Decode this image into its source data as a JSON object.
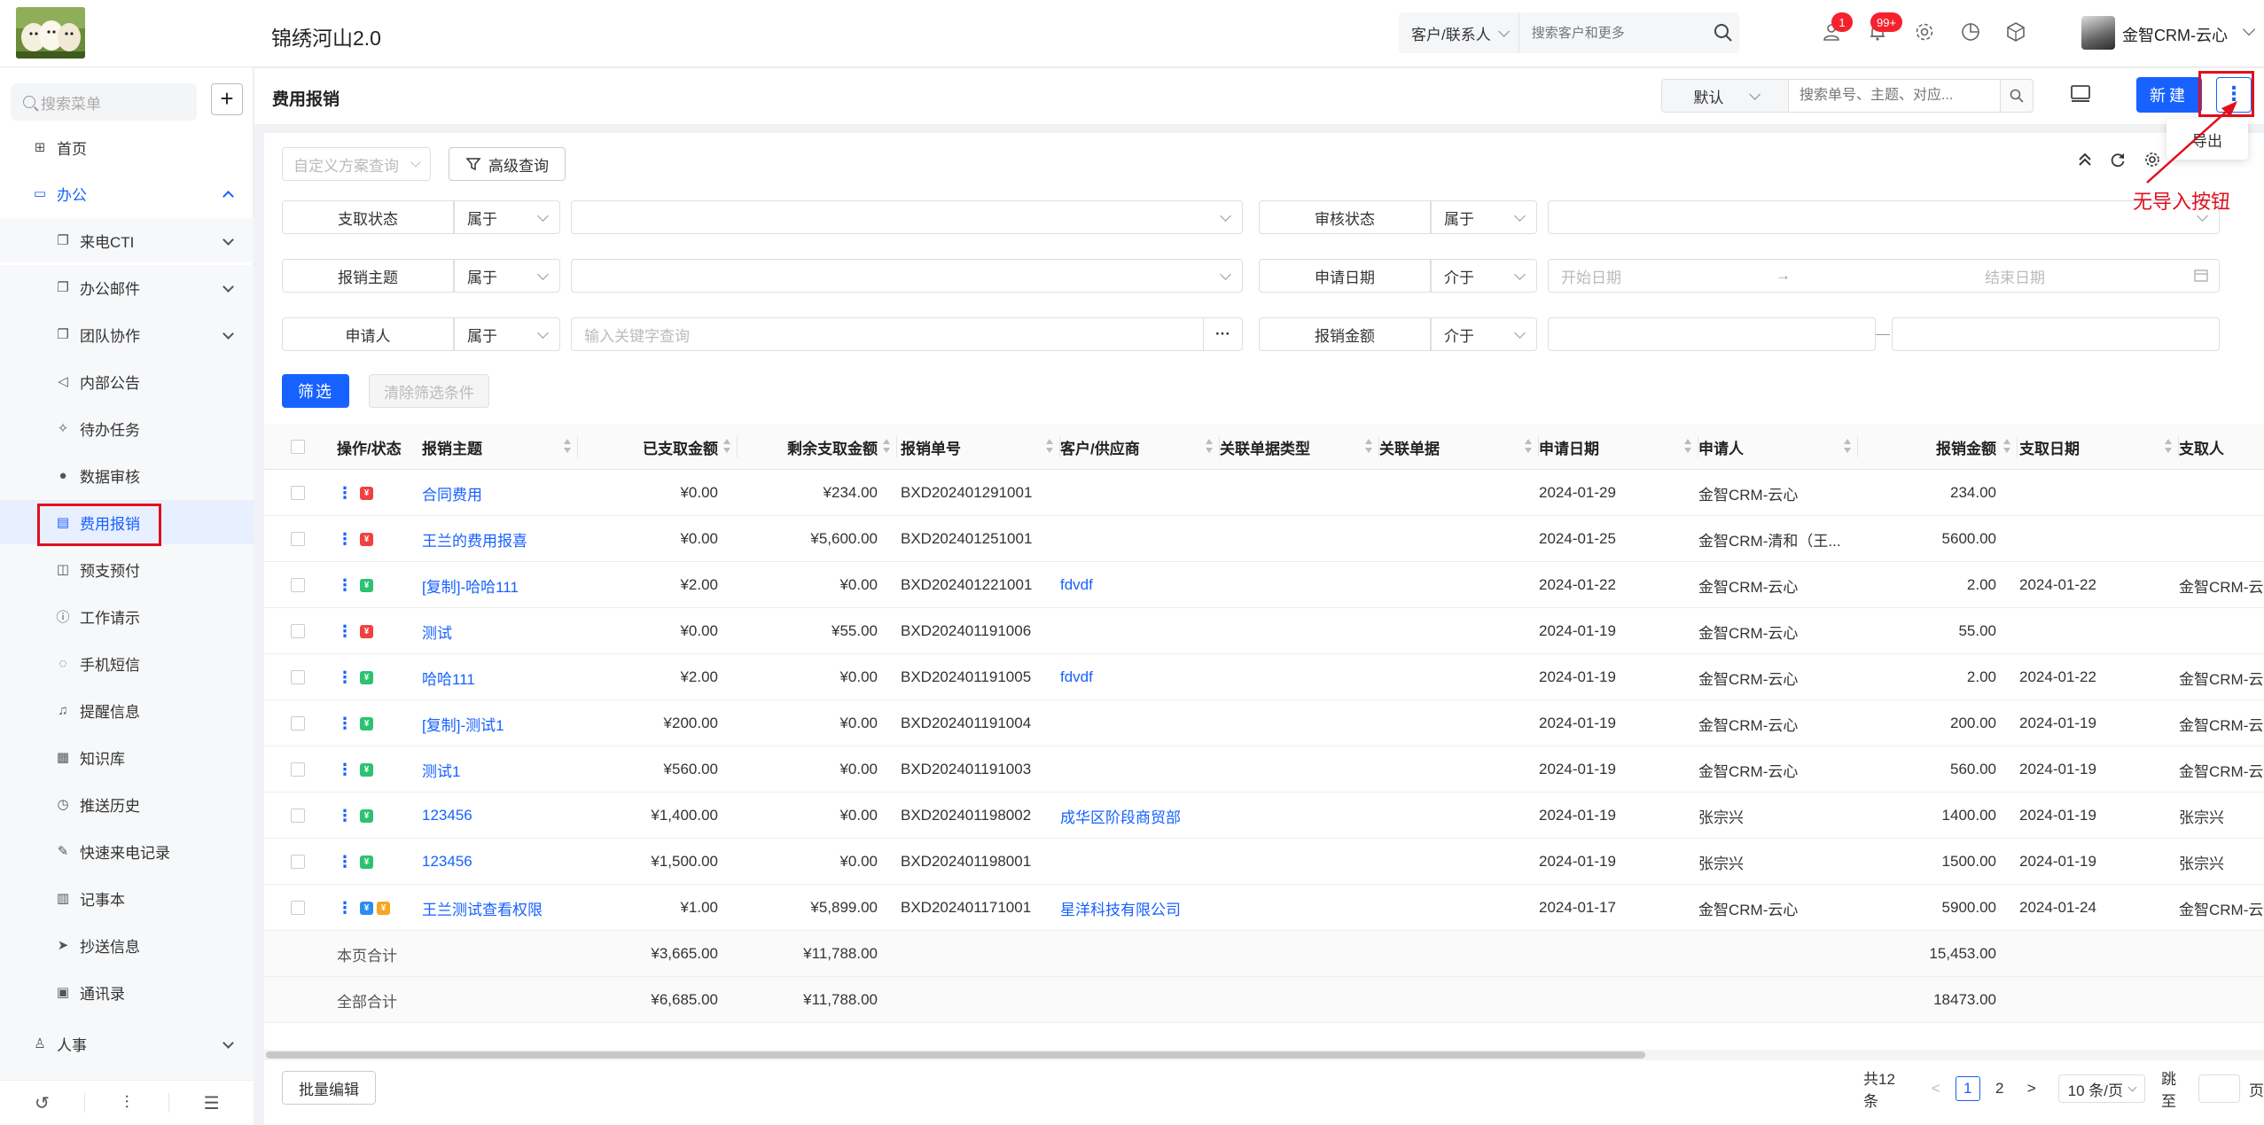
{
  "header": {
    "app_title": "锦绣河山2.0",
    "search_type": "客户/联系人",
    "search_placeholder": "搜索客户和更多",
    "badge_tasks": "1",
    "badge_notices": "99+",
    "user_name": "金智CRM-云心"
  },
  "sidebar": {
    "search_placeholder": "搜索菜单",
    "add_label": "+",
    "items": [
      {
        "label": "首页"
      },
      {
        "label": "办公"
      },
      {
        "label": "来电CTI"
      },
      {
        "label": "办公邮件"
      },
      {
        "label": "团队协作"
      },
      {
        "label": "内部公告"
      },
      {
        "label": "待办任务"
      },
      {
        "label": "数据审核"
      },
      {
        "label": "费用报销"
      },
      {
        "label": "预支预付"
      },
      {
        "label": "工作请示"
      },
      {
        "label": "手机短信"
      },
      {
        "label": "提醒信息"
      },
      {
        "label": "知识库"
      },
      {
        "label": "推送历史"
      },
      {
        "label": "快速来电记录"
      },
      {
        "label": "记事本"
      },
      {
        "label": "抄送信息"
      },
      {
        "label": "通讯录"
      },
      {
        "label": "人事"
      }
    ]
  },
  "page": {
    "title": "费用报销",
    "scheme": "默认",
    "quick_search_placeholder": "搜索单号、主题、对应...",
    "new_label": "新建",
    "more_label": "⋮",
    "export_label": "导出",
    "annotation": "无导入按钮"
  },
  "filters": {
    "custom_scheme_placeholder": "自定义方案查询",
    "advanced_label": "高级查询",
    "rows": [
      {
        "label": "支取状态",
        "op": "属于",
        "value": "",
        "label2": "审核状态",
        "op2": "属于",
        "value2": ""
      },
      {
        "label": "报销主题",
        "op": "属于",
        "value": "",
        "label2": "申请日期",
        "op2": "介于",
        "start": "开始日期",
        "end": "结束日期"
      },
      {
        "label": "申请人",
        "op": "属于",
        "value": "输入关键字查询",
        "label2": "报销金额",
        "op2": "介于"
      }
    ],
    "filter_btn": "筛选",
    "clear_btn": "清除筛选条件"
  },
  "table": {
    "columns": [
      "操作/状态",
      "报销主题",
      "已支取金额",
      "剩余支取金额",
      "报销单号",
      "客户/供应商",
      "关联单据类型",
      "关联单据",
      "申请日期",
      "申请人",
      "报销金额",
      "支取日期",
      "支取人"
    ],
    "rows": [
      {
        "status": [
          "red"
        ],
        "subject": "合同费用",
        "paid": "¥0.00",
        "remain": "¥234.00",
        "no": "BXD202401291001",
        "customer": "",
        "reltype": "",
        "rel": "",
        "date": "2024-01-29",
        "applicant": "金智CRM-云心",
        "amount": "234.00",
        "paydate": "",
        "payer": ""
      },
      {
        "status": [
          "red"
        ],
        "subject": "王兰的费用报喜",
        "paid": "¥0.00",
        "remain": "¥5,600.00",
        "no": "BXD202401251001",
        "customer": "",
        "reltype": "",
        "rel": "",
        "date": "2024-01-25",
        "applicant": "金智CRM-清和（王...",
        "amount": "5600.00",
        "paydate": "",
        "payer": ""
      },
      {
        "status": [
          "green"
        ],
        "subject": "[复制]-哈哈111",
        "paid": "¥2.00",
        "remain": "¥0.00",
        "no": "BXD202401221001",
        "customer": "fdvdf",
        "reltype": "",
        "rel": "",
        "date": "2024-01-22",
        "applicant": "金智CRM-云心",
        "amount": "2.00",
        "paydate": "2024-01-22",
        "payer": "金智CRM-云"
      },
      {
        "status": [
          "red"
        ],
        "subject": "测试",
        "paid": "¥0.00",
        "remain": "¥55.00",
        "no": "BXD202401191006",
        "customer": "",
        "reltype": "",
        "rel": "",
        "date": "2024-01-19",
        "applicant": "金智CRM-云心",
        "amount": "55.00",
        "paydate": "",
        "payer": ""
      },
      {
        "status": [
          "green"
        ],
        "subject": "哈哈111",
        "paid": "¥2.00",
        "remain": "¥0.00",
        "no": "BXD202401191005",
        "customer": "fdvdf",
        "reltype": "",
        "rel": "",
        "date": "2024-01-19",
        "applicant": "金智CRM-云心",
        "amount": "2.00",
        "paydate": "2024-01-22",
        "payer": "金智CRM-云"
      },
      {
        "status": [
          "green"
        ],
        "subject": "[复制]-测试1",
        "paid": "¥200.00",
        "remain": "¥0.00",
        "no": "BXD202401191004",
        "customer": "",
        "reltype": "",
        "rel": "",
        "date": "2024-01-19",
        "applicant": "金智CRM-云心",
        "amount": "200.00",
        "paydate": "2024-01-19",
        "payer": "金智CRM-云"
      },
      {
        "status": [
          "green"
        ],
        "subject": "测试1",
        "paid": "¥560.00",
        "remain": "¥0.00",
        "no": "BXD202401191003",
        "customer": "",
        "reltype": "",
        "rel": "",
        "date": "2024-01-19",
        "applicant": "金智CRM-云心",
        "amount": "560.00",
        "paydate": "2024-01-19",
        "payer": "金智CRM-云"
      },
      {
        "status": [
          "green"
        ],
        "subject": "123456",
        "paid": "¥1,400.00",
        "remain": "¥0.00",
        "no": "BXD202401198002",
        "customer": "成华区阶段商贸部",
        "reltype": "",
        "rel": "",
        "date": "2024-01-19",
        "applicant": "张宗兴",
        "amount": "1400.00",
        "paydate": "2024-01-19",
        "payer": "张宗兴"
      },
      {
        "status": [
          "green"
        ],
        "subject": "123456",
        "paid": "¥1,500.00",
        "remain": "¥0.00",
        "no": "BXD202401198001",
        "customer": "",
        "reltype": "",
        "rel": "",
        "date": "2024-01-19",
        "applicant": "张宗兴",
        "amount": "1500.00",
        "paydate": "2024-01-19",
        "payer": "张宗兴"
      },
      {
        "status": [
          "blue",
          "orange"
        ],
        "subject": "王兰测试查看权限",
        "paid": "¥1.00",
        "remain": "¥5,899.00",
        "no": "BXD202401171001",
        "customer": "星洋科技有限公司",
        "reltype": "",
        "rel": "",
        "date": "2024-01-17",
        "applicant": "金智CRM-云心",
        "amount": "5900.00",
        "paydate": "2024-01-24",
        "payer": "金智CRM-云"
      }
    ],
    "page_total": {
      "label": "本页合计",
      "paid": "¥3,665.00",
      "remain": "¥11,788.00",
      "amount": "15,453.00"
    },
    "all_total": {
      "label": "全部合计",
      "paid": "¥6,685.00",
      "remain": "¥11,788.00",
      "amount": "18473.00"
    }
  },
  "footer": {
    "batch_edit": "批量编辑",
    "total": "共12条",
    "prev": "<",
    "page1": "1",
    "page2": "2",
    "next": ">",
    "page_size": "10 条/页",
    "jump_label": "跳至",
    "page_unit": "页"
  },
  "colors": {
    "primary": "#1761ff",
    "annotation": "#e0101e",
    "status_red": "#f04040",
    "status_green": "#2cc270"
  }
}
